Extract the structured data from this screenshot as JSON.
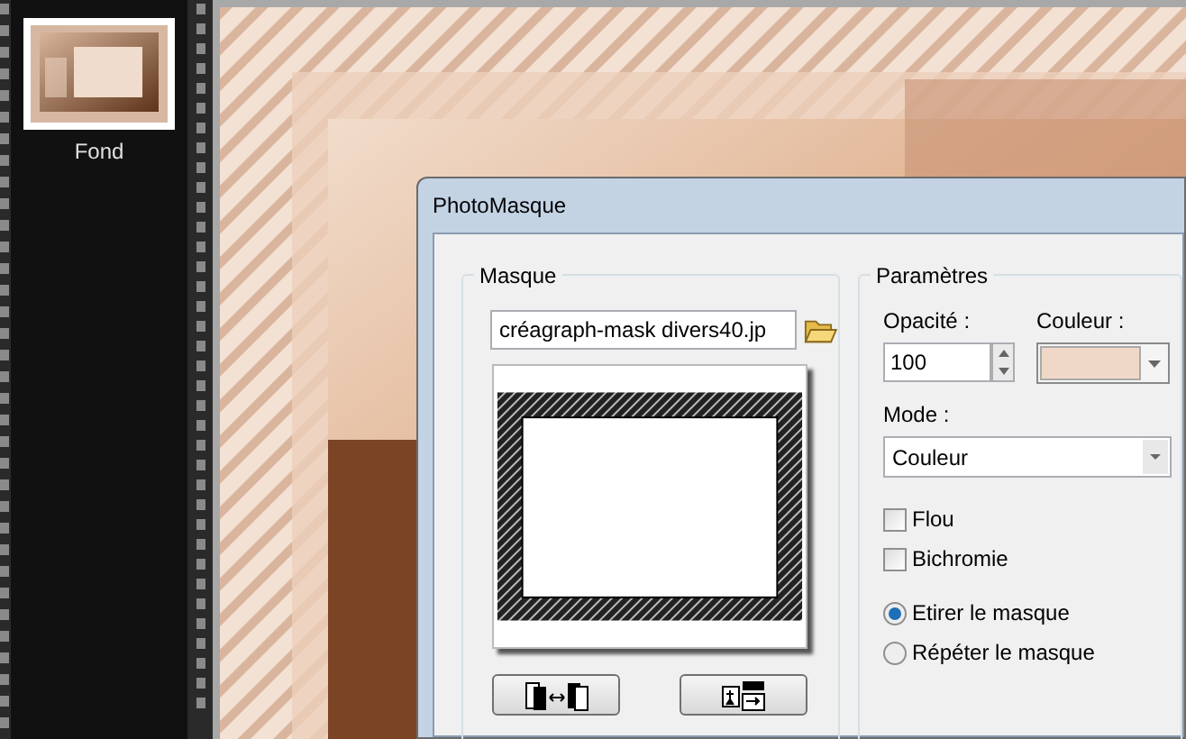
{
  "layers": [
    {
      "label": "Fond",
      "selected": true
    }
  ],
  "dialog": {
    "title": "PhotoMasque",
    "mask_group": {
      "title": "Masque",
      "file": "créagraph-mask divers40.jp"
    },
    "params_group": {
      "title": "Paramètres",
      "opacity": {
        "label": "Opacité :",
        "value": "100"
      },
      "color": {
        "label": "Couleur :",
        "color": "#f0d8c8"
      },
      "mode": {
        "label": "Mode :",
        "value": "Couleur"
      },
      "checkboxes": [
        {
          "label": "Flou",
          "checked": false
        },
        {
          "label": "Bichromie",
          "checked": false
        }
      ],
      "radios": [
        {
          "label": "Etirer le masque",
          "selected": true
        },
        {
          "label": "Répéter le masque",
          "selected": false
        }
      ]
    }
  }
}
